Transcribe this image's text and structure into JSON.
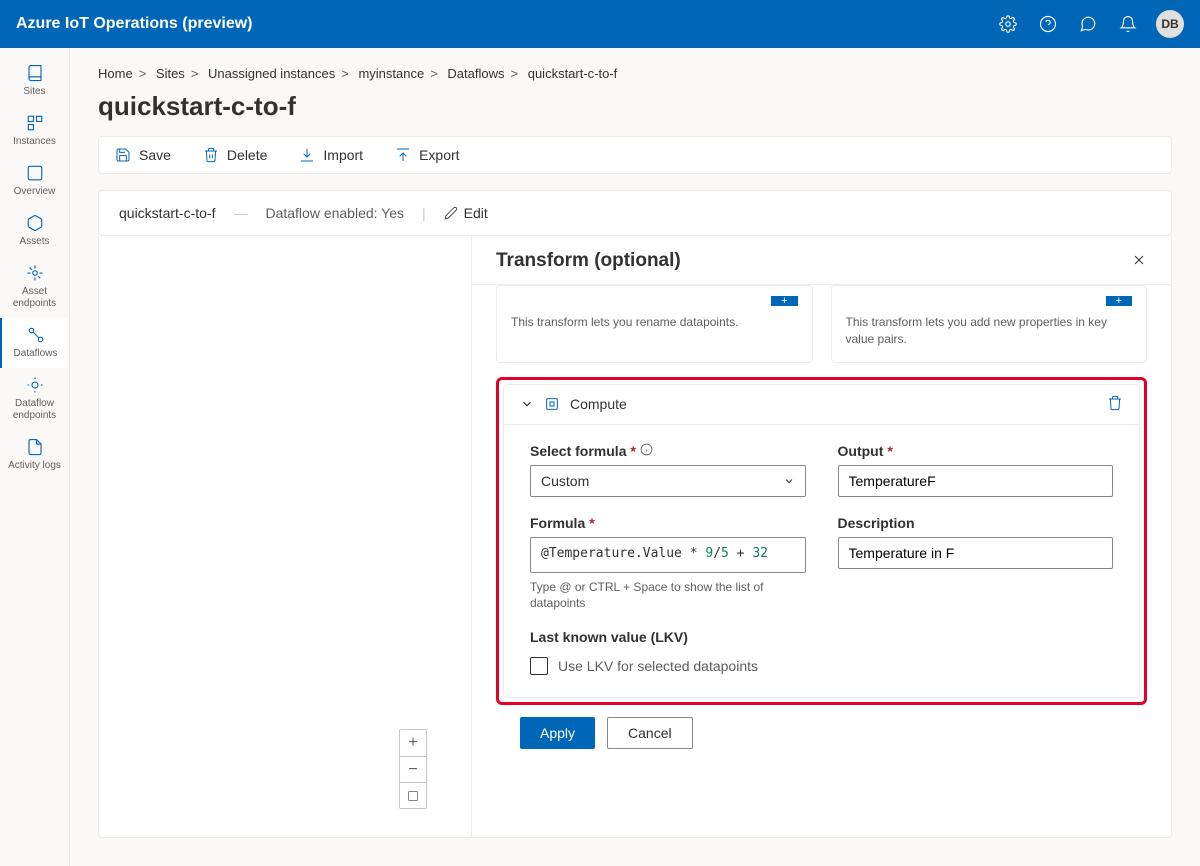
{
  "header": {
    "product": "Azure IoT Operations (preview)",
    "avatar": "DB"
  },
  "nav": {
    "items": [
      {
        "label": "Sites"
      },
      {
        "label": "Instances"
      },
      {
        "label": "Overview"
      },
      {
        "label": "Assets"
      },
      {
        "label": "Asset endpoints"
      },
      {
        "label": "Dataflows"
      },
      {
        "label": "Dataflow endpoints"
      },
      {
        "label": "Activity logs"
      }
    ]
  },
  "breadcrumbs": {
    "items": [
      "Home",
      "Sites",
      "Unassigned instances",
      "myinstance",
      "Dataflows",
      "quickstart-c-to-f"
    ]
  },
  "page": {
    "title": "quickstart-c-to-f"
  },
  "toolbar": {
    "save": "Save",
    "delete": "Delete",
    "import": "Import",
    "export": "Export"
  },
  "status": {
    "name": "quickstart-c-to-f",
    "enabled_label": "Dataflow enabled: Yes",
    "edit": "Edit"
  },
  "panel": {
    "title": "Transform (optional)",
    "cards": {
      "rename": {
        "desc": "This transform lets you rename datapoints."
      },
      "newprop": {
        "desc": "This transform lets you add new properties in key value pairs."
      }
    },
    "compute": {
      "title": "Compute",
      "select_formula_label": "Select formula",
      "select_formula_value": "Custom",
      "output_label": "Output",
      "output_value": "TemperatureF",
      "formula_label": "Formula",
      "formula_at": "@Temperature.Value",
      "formula_op1": " * ",
      "formula_n1": "9",
      "formula_slash": "/",
      "formula_n2": "5",
      "formula_op2": " + ",
      "formula_n3": "32",
      "formula_hint": "Type @ or CTRL + Space to show the list of datapoints",
      "description_label": "Description",
      "description_value": "Temperature in F",
      "lkv_label": "Last known value (LKV)",
      "lkv_checkbox": "Use LKV for selected datapoints"
    },
    "footer": {
      "apply": "Apply",
      "cancel": "Cancel"
    }
  }
}
